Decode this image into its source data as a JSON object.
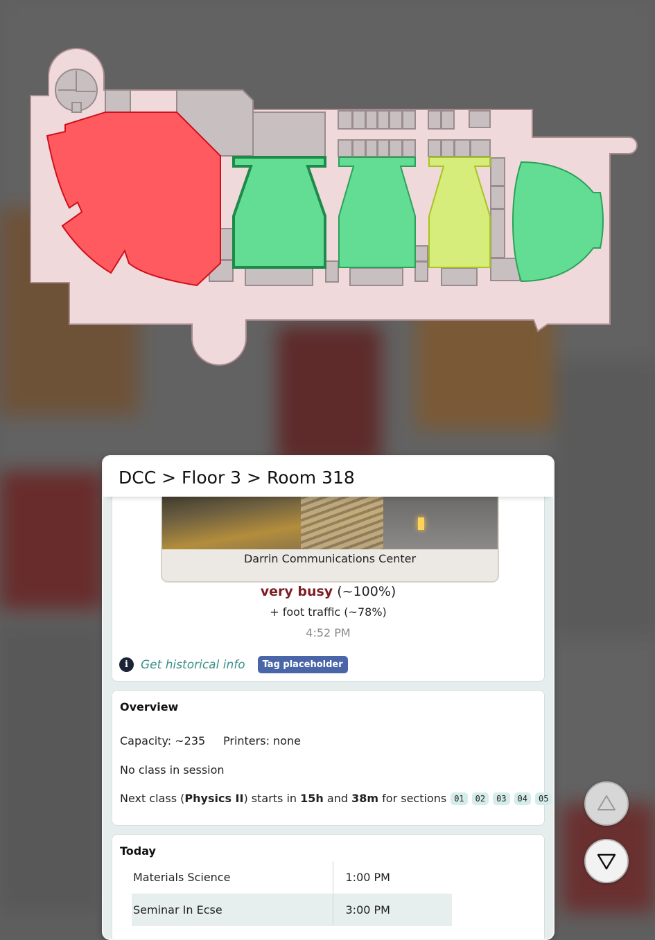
{
  "header": {
    "building": "DCC",
    "sep1": ">",
    "floor": "Floor 3",
    "sep2": ">",
    "room": "Room 318"
  },
  "photo": {
    "caption": "Darrin Communications Center"
  },
  "status": {
    "busy_label": "very busy",
    "busy_pct": "(~100%)",
    "foot_traffic": "+ foot traffic (~78%)",
    "time": "4:52 PM"
  },
  "history": {
    "info_glyph": "i",
    "link": "Get historical info",
    "tag": "Tag placeholder"
  },
  "overview": {
    "title": "Overview",
    "capacity": "Capacity: ~235",
    "printers": "Printers: none",
    "no_class": "No class in session",
    "next_prefix": "Next class (",
    "next_course": "Physics II",
    "next_mid": ") starts in",
    "next_hours": "15h",
    "next_and": "and",
    "next_minutes": "38m",
    "next_suffix": "for sections",
    "sections": [
      "01",
      "02",
      "03",
      "04",
      "05"
    ]
  },
  "today": {
    "title": "Today",
    "rows": [
      {
        "course": "Materials Science",
        "time": "1:00 PM"
      },
      {
        "course": "Seminar In Ecse",
        "time": "3:00 PM"
      }
    ]
  },
  "controls": {
    "up_icon": "triangle-up-icon",
    "down_icon": "triangle-down-icon"
  },
  "colors": {
    "very_busy": "#ff5a5f",
    "busy_green": "#63dd94",
    "moderate_yellow": "#d6ec7b",
    "floor_fill": "#efd9da",
    "accent_teal": "#3c8f8a",
    "tag_blue": "#4a65a8"
  }
}
